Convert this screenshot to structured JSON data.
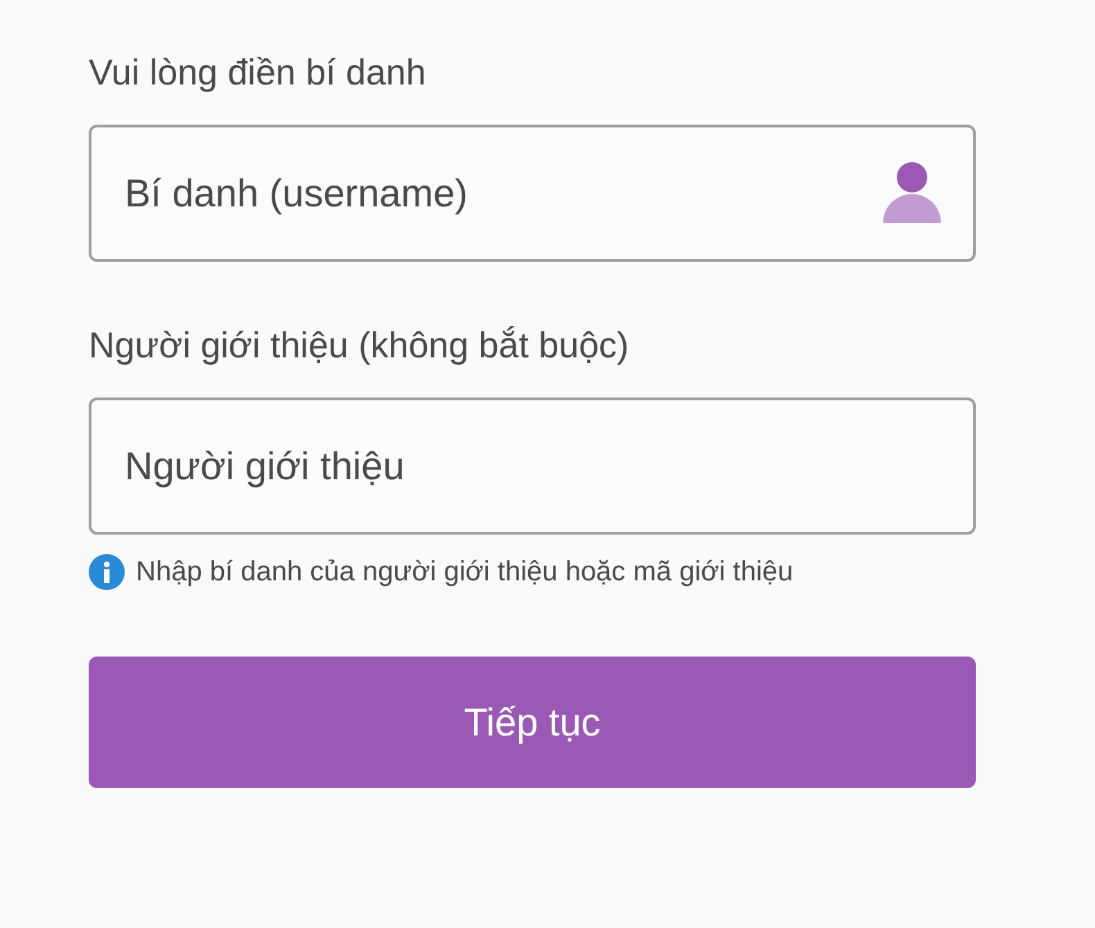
{
  "fields": [
    {
      "label": "Vui lòng điền bí danh",
      "placeholder": "Bí danh (username)"
    },
    {
      "label": "Người giới thiệu (không bắt buộc)",
      "placeholder": "Người giới thiệu",
      "hint": "Nhập bí danh của người giới thiệu hoặc mã giới thiệu"
    }
  ],
  "button": {
    "label": "Tiếp tục"
  }
}
